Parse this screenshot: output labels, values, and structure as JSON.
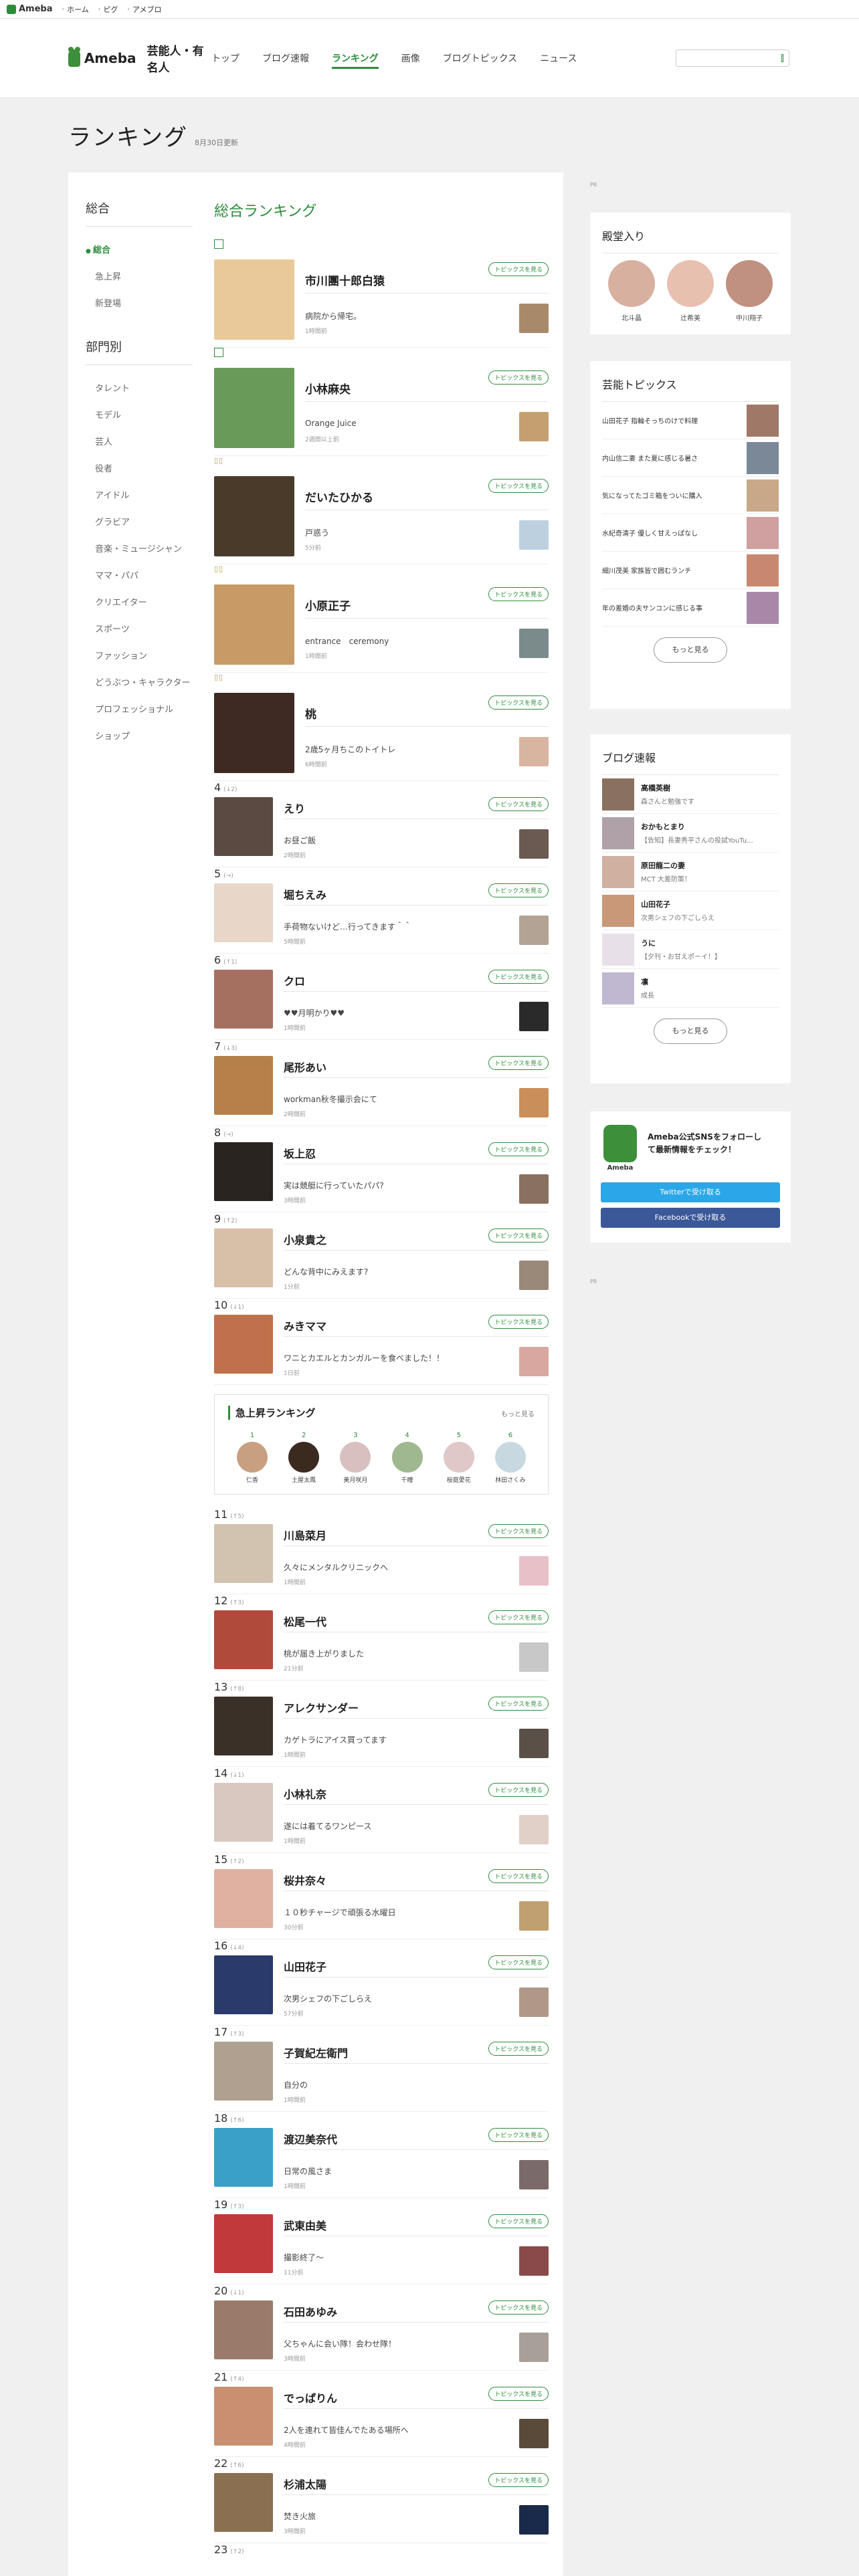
{
  "topbar": {
    "logo": "Ameba",
    "links": [
      "ホーム",
      "ピグ",
      "アメブロ"
    ]
  },
  "header": {
    "brand": "Ameba",
    "sub": "芸能人・有名人",
    "nav": [
      "トップ",
      "ブログ速報",
      "ランキング",
      "画像",
      "ブログトピックス",
      "ニュース"
    ],
    "active_index": 2
  },
  "page": {
    "title": "ランキング",
    "updated": "8月30日更新"
  },
  "left_nav": {
    "overall_title": "総合",
    "overall_items": [
      "総合",
      "急上昇",
      "新登場"
    ],
    "category_title": "部門別",
    "categories": [
      "タレント",
      "モデル",
      "芸人",
      "役者",
      "アイドル",
      "グラビア",
      "音楽・ミュージシャン",
      "ママ・パパ",
      "クリエイター",
      "スポーツ",
      "ファッション",
      "どうぶつ・キャラクター",
      "プロフェッショナル",
      "ショップ"
    ]
  },
  "ranking": {
    "title": "総合ランキング",
    "topic_button": "トピックスを見る",
    "top": [
      {
        "rank": "1",
        "name": "市川團十郎白猿",
        "title": "病院から帰宅。",
        "time": "1時間前",
        "avatar": "#e9c99a",
        "thumb": "#a88a6a"
      },
      {
        "rank": "2",
        "name": "小林麻央",
        "title": "Orange Juice",
        "time": "2週間以上前",
        "avatar": "#6a9a5a",
        "thumb": "#c4a070"
      },
      {
        "rank": "3",
        "name": "だいたひかる",
        "title": "戸惑う",
        "time": "5分前",
        "avatar": "#4a3a2a",
        "thumb": "#bcd0e0"
      },
      {
        "rank": "4",
        "name": "小原正子",
        "title": "entrance　ceremony",
        "time": "1時間前",
        "avatar": "#c79a66",
        "thumb": "#7b8a8a"
      },
      {
        "rank": "5",
        "name": "桃",
        "title": "2歳5ヶ月ちこのトイトレ",
        "time": "6時間前",
        "avatar": "#3e2a22",
        "thumb": "#d8b5a0"
      }
    ],
    "rest_a": [
      {
        "rank": "4",
        "chg": "(↓2)",
        "name": "えり",
        "title": "お昼ご飯",
        "time": "2時間前",
        "avatar": "#5a4a42",
        "thumb": "#6a5a52"
      },
      {
        "rank": "5",
        "chg": "(→)",
        "name": "堀ちえみ",
        "title": "手荷物ないけど…行ってきます＾＾",
        "time": "5時間前",
        "avatar": "#e8d6c8",
        "thumb": "#b3a394"
      },
      {
        "rank": "6",
        "chg": "(↑1)",
        "name": "クロ",
        "title": "♥♥月明かり♥♥",
        "time": "1時間前",
        "avatar": "#a67060",
        "thumb": "#2a2a2a"
      },
      {
        "rank": "7",
        "chg": "(↓3)",
        "name": "尾形あい",
        "title": "workman秋冬撮示会にて",
        "time": "2時間前",
        "avatar": "#b5804a",
        "thumb": "#c98e5a"
      },
      {
        "rank": "8",
        "chg": "(→)",
        "name": "坂上忍",
        "title": "実は競艇に行っていたパパ?",
        "time": "3時間前",
        "avatar": "#2a2420",
        "thumb": "#8a7060"
      },
      {
        "rank": "9",
        "chg": "(↑2)",
        "name": "小泉貴之",
        "title": "どんな背中にみえます?",
        "time": "1分前",
        "avatar": "#d8c0a8",
        "thumb": "#9a8878"
      },
      {
        "rank": "10",
        "chg": "(↓1)",
        "name": "みきママ",
        "title": "ワニとカエルとカンガルーを食べました！！",
        "time": "1日前",
        "avatar": "#c0704a",
        "thumb": "#d8a8a0"
      }
    ],
    "rising": {
      "title": "急上昇ランキング",
      "more": "もっと見る",
      "items": [
        {
          "no": "1",
          "name": "仁香"
        },
        {
          "no": "2",
          "name": "土屋太鳳"
        },
        {
          "no": "3",
          "name": "美月咲月"
        },
        {
          "no": "4",
          "name": "千瞳"
        },
        {
          "no": "5",
          "name": "桜庭愛花"
        },
        {
          "no": "6",
          "name": "林田さくみ"
        }
      ]
    },
    "rest_b": [
      {
        "rank": "11",
        "chg": "(↑5)",
        "name": "川島菜月",
        "title": "久々にメンタルクリニックへ",
        "time": "1時間前",
        "avatar": "#d2c2b0",
        "thumb": "#e8c0c8"
      },
      {
        "rank": "12",
        "chg": "(↑3)",
        "name": "松尾一代",
        "title": "桃が届き上がりました",
        "time": "21分前",
        "avatar": "#b04a3a",
        "thumb": "#c8c8c8"
      },
      {
        "rank": "13",
        "chg": "(↑8)",
        "name": "アレクサンダー",
        "title": "カゲトラにアイス買ってます",
        "time": "1時間前",
        "avatar": "#3a3028",
        "thumb": "#5a5048"
      },
      {
        "rank": "14",
        "chg": "(↓1)",
        "name": "小林礼奈",
        "title": "遂には着てるワンピース",
        "time": "1時間前",
        "avatar": "#d8c8c0",
        "thumb": "#e0d0c8"
      },
      {
        "rank": "15",
        "chg": "(↑2)",
        "name": "桜井奈々",
        "title": "１０秒チャージで頑張る水曜日",
        "time": "30分前",
        "avatar": "#e0b0a0",
        "thumb": "#c0a070"
      },
      {
        "rank": "16",
        "chg": "(↓4)",
        "name": "山田花子",
        "title": "次男シェフの下ごしらえ",
        "time": "57分前",
        "avatar": "#2a3a6a",
        "thumb": "#b09888"
      },
      {
        "rank": "17",
        "chg": "(↑3)",
        "name": "子賀紀左衛門",
        "title": "自分の",
        "time": "1時間前",
        "avatar": "#b0a090",
        "thumb": "#ffffff"
      },
      {
        "rank": "18",
        "chg": "(↑6)",
        "name": "渡辺美奈代",
        "title": "日常の風さま",
        "time": "1時間前",
        "avatar": "#3aa0c8",
        "thumb": "#7a6a6a"
      },
      {
        "rank": "19",
        "chg": "(↑3)",
        "name": "武東由美",
        "title": "撮影終了～",
        "time": "11分前",
        "avatar": "#c03a3a",
        "thumb": "#8a4a4a"
      },
      {
        "rank": "20",
        "chg": "(↓1)",
        "name": "石田あゆみ",
        "title": "父ちゃんに会い隊！会わせ隊！",
        "time": "3時間前",
        "avatar": "#9a7a6a",
        "thumb": "#a8a098"
      },
      {
        "rank": "21",
        "chg": "(↑4)",
        "name": "でっぱりん",
        "title": "2人を連れて皆佳んでたある場所へ",
        "time": "4時間前",
        "avatar": "#c89070",
        "thumb": "#5a4a3a"
      },
      {
        "rank": "22",
        "chg": "(↑6)",
        "name": "杉浦太陽",
        "title": "焚き火旅",
        "time": "3時間前",
        "avatar": "#8a7050",
        "thumb": "#1a2a4a"
      }
    ],
    "last_rank": "23",
    "last_chg": "(↑2)"
  },
  "sidebar": {
    "pr": "PR",
    "dendo": {
      "title": "殿堂入り",
      "items": [
        {
          "name": "北斗晶",
          "c": "#d8b0a0"
        },
        {
          "name": "辻希美",
          "c": "#e8c0b0"
        },
        {
          "name": "中川翔子",
          "c": "#c09080"
        }
      ]
    },
    "topics": {
      "title": "芸能トピックス",
      "items": [
        "山田花子 指輪そっちのけで料理",
        "内山信二妻 また夏に感じる暑さ",
        "気になってたゴミ箱をついに購入",
        "水紀奇清子 優しく甘えっぱなし",
        "細川茂美 家族皆で囲むランチ",
        "年の差婚の夫サンコンに感じる事"
      ],
      "more": "もっと見る"
    },
    "blogs": {
      "title": "ブログ速報",
      "items": [
        {
          "name": "高橋英樹",
          "text": "森さんと勉強です"
        },
        {
          "name": "おかもとまり",
          "text": "【告知】長妻秀平さんの投試YouTu..."
        },
        {
          "name": "原田龍二の妻",
          "text": "MCT 大差防策！"
        },
        {
          "name": "山田花子",
          "text": "次男シェフの下ごしらえ"
        },
        {
          "name": "うに",
          "text": "【夕刊・お甘えポーイ！】"
        },
        {
          "name": "凛",
          "text": "成長"
        }
      ],
      "more": "もっと見る"
    },
    "sns": {
      "text": "Ameba公式SNSをフォローして最新情報をチェック！",
      "twitter": "Twitterで受け取る",
      "facebook": "Facebookで受け取る"
    }
  }
}
